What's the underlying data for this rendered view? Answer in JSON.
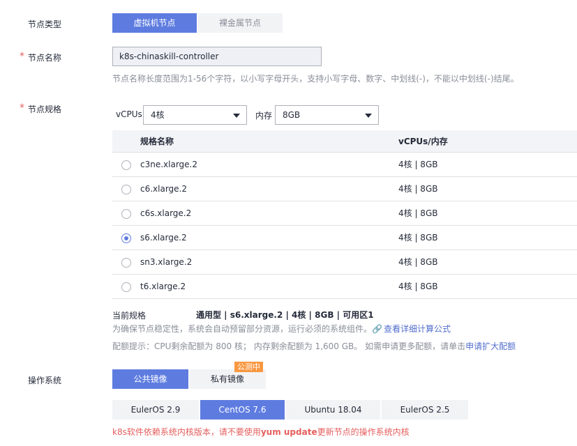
{
  "node_type": {
    "label": "节点类型",
    "options": [
      "虚拟机节点",
      "裸金属节点"
    ],
    "selected": "虚拟机节点"
  },
  "node_name": {
    "label": "节点名称",
    "value": "k8s-chinaskill-controller",
    "hint": "节点名称长度范围为1-56个字符，以小写字母开头，支持小写字母、数字、中划线(-)，不能以中划线(-)结尾。"
  },
  "node_spec": {
    "label": "节点规格",
    "vcpu_label": "vCPUs",
    "vcpu_value": "4核",
    "memory_label": "内存",
    "memory_value": "8GB",
    "columns": [
      "规格名称",
      "vCPUs/内存"
    ],
    "rows": [
      {
        "name": "c3ne.xlarge.2",
        "spec": "4核 | 8GB",
        "selected": false
      },
      {
        "name": "c6.xlarge.2",
        "spec": "4核 | 8GB",
        "selected": false
      },
      {
        "name": "c6s.xlarge.2",
        "spec": "4核 | 8GB",
        "selected": false
      },
      {
        "name": "s6.xlarge.2",
        "spec": "4核 | 8GB",
        "selected": true
      },
      {
        "name": "sn3.xlarge.2",
        "spec": "4核 | 8GB",
        "selected": false
      },
      {
        "name": "t6.xlarge.2",
        "spec": "4核 | 8GB",
        "selected": false
      }
    ],
    "current_label": "当前规格",
    "current_value": "通用型 | s6.xlarge.2 | 4核 | 8GB | 可用区1",
    "reserve_note": "为确保节点稳定性，系统会自动预留部分资源，运行必须的系统组件。",
    "reserve_link": "查看详细计算公式",
    "quota_note": "配额提示：CPU剩余配额为 800 核； 内存剩余配额为 1,600 GB。 如需申请更多配额，请单击",
    "quota_link": "申请扩大配额"
  },
  "os": {
    "label": "操作系统",
    "tabs": [
      "公共镜像",
      "私有镜像"
    ],
    "selected_tab": "公共镜像",
    "badge": "公测中",
    "options": [
      "EulerOS 2.9",
      "CentOS 7.6",
      "Ubuntu 18.04",
      "EulerOS 2.5"
    ],
    "selected": "CentOS 7.6",
    "warning_prefix": "k8s软件依赖系统内核版本，请不要使用",
    "warning_bold": "yum update",
    "warning_suffix": "更新节点的操作系统内核"
  },
  "colors": {
    "primary": "#5e7ce0",
    "required": "#e55e5e",
    "badge": "#fa9841",
    "link": "#526ecc"
  }
}
